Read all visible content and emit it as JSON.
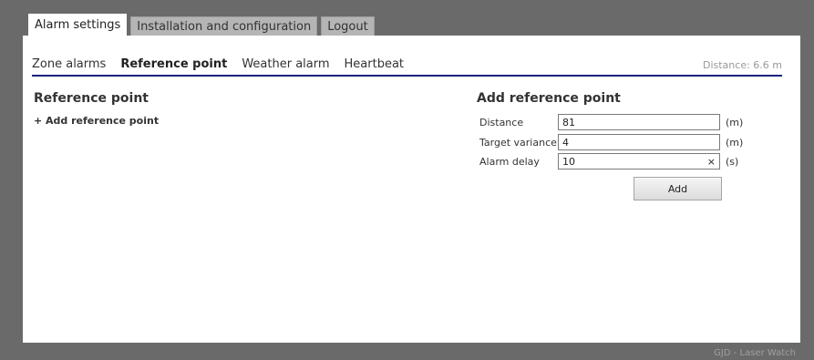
{
  "tabs": [
    {
      "label": "Alarm settings",
      "active": true
    },
    {
      "label": "Installation and configuration",
      "active": false
    },
    {
      "label": "Logout",
      "active": false
    }
  ],
  "subnav": {
    "items": [
      {
        "label": "Zone alarms",
        "active": false
      },
      {
        "label": "Reference point",
        "active": true
      },
      {
        "label": "Weather alarm",
        "active": false
      },
      {
        "label": "Heartbeat",
        "active": false
      }
    ],
    "distance": "Distance: 6.6 m"
  },
  "left": {
    "heading": "Reference point",
    "add_link": "+ Add reference point"
  },
  "form": {
    "heading": "Add reference point",
    "fields": [
      {
        "label": "Distance",
        "value": "81",
        "unit": "(m)"
      },
      {
        "label": "Target variance",
        "value": "4",
        "unit": "(m)"
      },
      {
        "label": "Alarm delay",
        "value": "10",
        "unit": "(s)",
        "clear": "×"
      }
    ],
    "add_label": "Add"
  },
  "footer": "GJD - Laser Watch",
  "colors": {
    "accent_rule": "#1a237e",
    "background": "#6a6a6a",
    "panel": "#ffffff"
  }
}
